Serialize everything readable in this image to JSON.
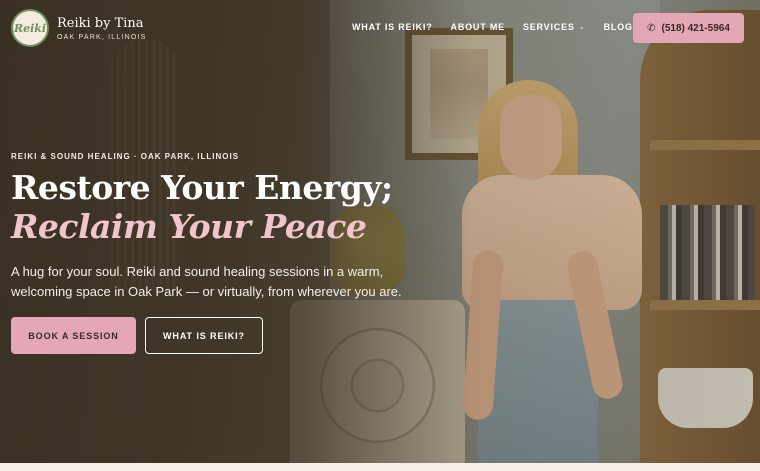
{
  "brand": {
    "badge_text": "Reiki",
    "title": "Reiki by Tina",
    "subtitle": "OAK PARK, ILLINOIS"
  },
  "nav": {
    "items": [
      {
        "label": "WHAT IS REIKI?"
      },
      {
        "label": "ABOUT ME"
      },
      {
        "label": "SERVICES",
        "has_dropdown": true
      },
      {
        "label": "BLOG"
      }
    ],
    "dropdown_icon": "chevron-down-icon"
  },
  "call": {
    "icon": "phone-icon",
    "label": "(518) 421-5964"
  },
  "hero": {
    "eyebrow": "REIKI & SOUND HEALING · OAK PARK, ILLINOIS",
    "headline_line1": "Restore Your Energy;",
    "headline_line2": "Reclaim Your Peace",
    "lede": "A hug for your soul. Reiki and sound healing sessions in a warm, welcoming space in Oak Park — or virtually, from wherever you are.",
    "primary_cta": "BOOK A SESSION",
    "secondary_cta": "WHAT IS REIKI?"
  },
  "colors": {
    "accent_pink": "#e3a7b5",
    "headline_pink": "#f0c5cd",
    "brand_green": "#6f8f5c"
  }
}
